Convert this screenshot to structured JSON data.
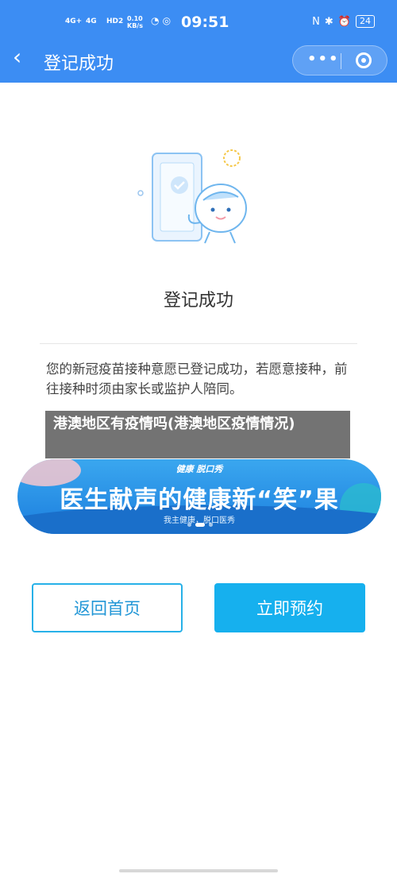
{
  "status_bar": {
    "signal1": "4G+",
    "signal2": "4G",
    "hd": "HD2",
    "speed": "0.10 KB/s",
    "time": "09:51",
    "battery": "24"
  },
  "nav": {
    "title": "登记成功",
    "more_label": "•••"
  },
  "main": {
    "heading": "登记成功",
    "description": "您的新冠疫苗接种意愿已登记成功，若愿意接种，前往接种时须由家长或监护人陪同。"
  },
  "overlay": {
    "text": "港澳地区有疫情吗(港澳地区疫情情况)"
  },
  "banner": {
    "logo": "健康 脱口秀",
    "text": "医生献声的健康新“笑”果",
    "sub": "我主健康，脱口医秀"
  },
  "buttons": {
    "home": "返回首页",
    "book": "立即预约"
  },
  "colors": {
    "primary": "#3c8df3",
    "button_blue": "#16b0ee",
    "button_border": "#27b1e8"
  }
}
